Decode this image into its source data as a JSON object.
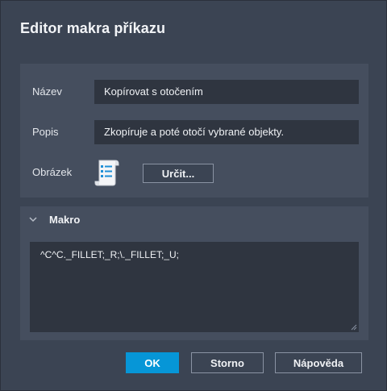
{
  "window": {
    "title": "Editor makra příkazu"
  },
  "properties": {
    "name_label": "Název",
    "name_value": "Kopírovat s otočením",
    "desc_label": "Popis",
    "desc_value": "Zkopíruje a poté otočí vybrané objekty.",
    "image_label": "Obrázek",
    "image_icon": "command-list-icon",
    "define_label": "Určit..."
  },
  "macro": {
    "title": "Makro",
    "value": "^C^C._FILLET;_R;\\._FILLET;_U;"
  },
  "buttons": {
    "ok": "OK",
    "cancel": "Storno",
    "help": "Nápověda"
  },
  "colors": {
    "background": "#3b4453",
    "panel": "#454e5e",
    "field": "#2f3540",
    "accent": "#0696d7"
  }
}
